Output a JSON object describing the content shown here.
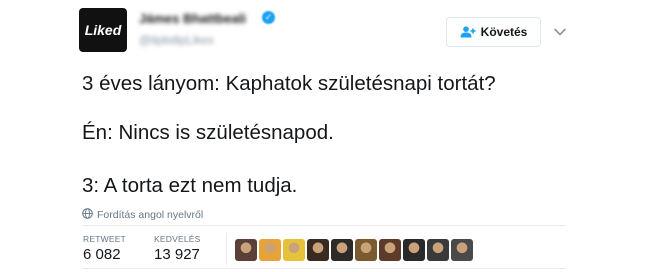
{
  "account": {
    "avatar_text": "Liked",
    "name": "Jámes Bhattbeali",
    "handle": "@lipbdlpLikes",
    "verified_color": "#1da1f2"
  },
  "follow_button": {
    "label": "Követés",
    "icon": "add-user-icon"
  },
  "tweet": {
    "lines": [
      "3 éves lányom: Kaphatok születésnapi tortát?",
      "Én: Nincs is születésnapod.",
      "3: A torta ezt nem tudja."
    ]
  },
  "translate": {
    "label": "Fordítás angol nyelvről",
    "icon": "globe-icon"
  },
  "stats": {
    "retweet_label": "RETWEET",
    "retweet_value": "6 082",
    "likes_label": "KEDVELÉS",
    "likes_value": "13 927"
  },
  "likers": [
    {
      "name": "liker-avatar-1",
      "color": "#5a4038"
    },
    {
      "name": "liker-avatar-2",
      "color": "#e8a23a"
    },
    {
      "name": "liker-avatar-3",
      "color": "#e6c23a"
    },
    {
      "name": "liker-avatar-4",
      "color": "#3b2a20"
    },
    {
      "name": "liker-avatar-5",
      "color": "#2e2a28"
    },
    {
      "name": "liker-avatar-6",
      "color": "#7a5a2e"
    },
    {
      "name": "liker-avatar-7",
      "color": "#5e3a2a"
    },
    {
      "name": "liker-avatar-8",
      "color": "#2a2a2a"
    },
    {
      "name": "liker-avatar-9",
      "color": "#3a3a3a"
    },
    {
      "name": "liker-avatar-10",
      "color": "#4a4a4a"
    }
  ]
}
